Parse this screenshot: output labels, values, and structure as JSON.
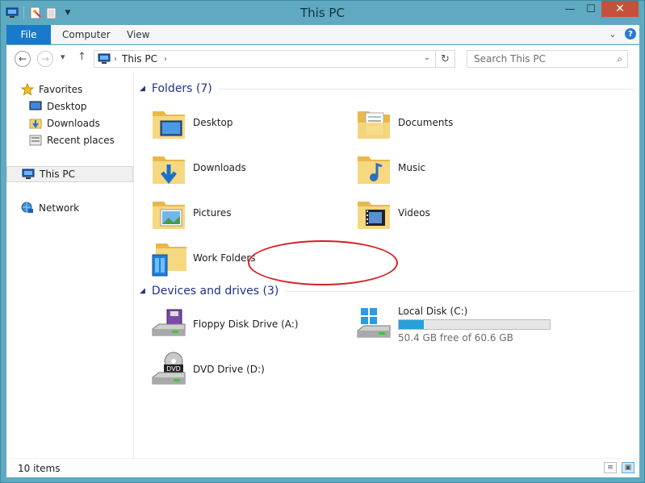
{
  "window": {
    "title": "This PC"
  },
  "title_controls": {
    "minimize": "—",
    "maximize": "☐",
    "close": "✕"
  },
  "ribbon": {
    "tabs": [
      "File",
      "Computer",
      "View"
    ],
    "collapse_icon": "chevron-down-icon",
    "help_label": "?"
  },
  "nav": {
    "back_icon": "arrow-left-icon",
    "forward_icon": "arrow-right-icon",
    "up_icon": "arrow-up-icon",
    "address": {
      "crumb": "This PC"
    },
    "search_placeholder": "Search This PC"
  },
  "sidebar": {
    "favorites": {
      "label": "Favorites",
      "items": [
        {
          "label": "Desktop",
          "icon": "desktop-icon"
        },
        {
          "label": "Downloads",
          "icon": "downloads-icon"
        },
        {
          "label": "Recent places",
          "icon": "recent-places-icon"
        }
      ]
    },
    "this_pc": {
      "label": "This PC",
      "selected": true
    },
    "network": {
      "label": "Network"
    }
  },
  "content": {
    "folders_group": {
      "label": "Folders (7)"
    },
    "folders": [
      {
        "label": "Desktop",
        "icon": "desktop-folder-icon"
      },
      {
        "label": "Documents",
        "icon": "documents-folder-icon"
      },
      {
        "label": "Downloads",
        "icon": "downloads-folder-icon"
      },
      {
        "label": "Music",
        "icon": "music-folder-icon"
      },
      {
        "label": "Pictures",
        "icon": "pictures-folder-icon"
      },
      {
        "label": "Videos",
        "icon": "videos-folder-icon"
      },
      {
        "label": "Work Folders",
        "icon": "work-folders-icon"
      }
    ],
    "drives_group": {
      "label": "Devices and drives (3)"
    },
    "drives": [
      {
        "label": "Floppy Disk Drive (A:)",
        "icon": "floppy-drive-icon"
      },
      {
        "label": "Local Disk (C:)",
        "icon": "local-disk-icon",
        "free_text": "50.4 GB free of 60.6 GB",
        "used_fraction": 0.168
      },
      {
        "label": "DVD Drive (D:)",
        "icon": "dvd-drive-icon",
        "badge": "DVD"
      }
    ]
  },
  "status": {
    "item_count": "10 items"
  },
  "colors": {
    "accent": "#1979ca",
    "group_header": "#1e3287",
    "highlight": "#d71f1f",
    "frame": "#5fa9c1"
  }
}
